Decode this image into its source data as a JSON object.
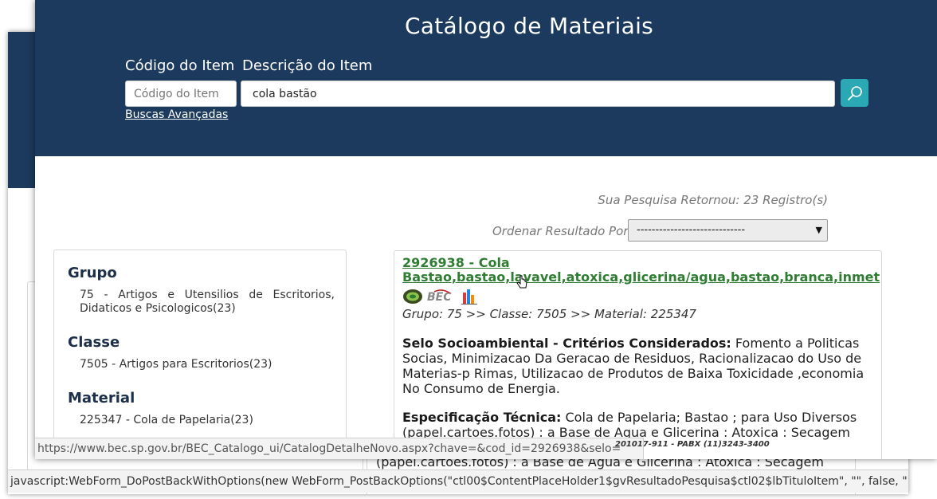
{
  "app": {
    "title": "Catálogo de Materiais"
  },
  "search": {
    "code_label": "Código do Item",
    "desc_label": "Descrição do Item",
    "code_placeholder": "Código do Item",
    "desc_value": "cola bastão",
    "advanced_link": "Buscas Avançadas",
    "search_icon": "search-icon"
  },
  "results_info": {
    "count_text": "Sua Pesquisa Retornou: 23 Registro(s)",
    "order_label": "Ordenar Resultado Por:",
    "order_value": "-----------------------------"
  },
  "filters": {
    "group_header": "Grupo",
    "group_item": "75 - Artigos e Utensilios de Escritorios, Didaticos e Psicologicos(23)",
    "class_header": "Classe",
    "class_item": "7505 - Artigos para Escritorios(23)",
    "material_header": "Material",
    "material_item": "225347 - Cola de Papelaria(23)"
  },
  "result": {
    "title_line1": "2926938 - Cola",
    "title_line2": "Bastao,bastao,lavavel,atoxica,glicerina/agua,bastao,branca,inmet",
    "path": "Grupo: 75 >> Classe: 7505 >> Material: 225347",
    "selo_label": "Selo Socioambiental - Critérios Considerados:",
    "selo_text": "Fomento a Politicas Socias, Minimizacao Da Geracao de Residuos, Racionalizacao do Uso de Materias-p Rimas, Utilizacao de Produtos de Baixa Toxicidade ,economia No Consumo de Energia.",
    "spec_label": "Especificação Técnica:",
    "spec_text": "Cola de Papelaria; Bastao ; para Uso Diversos (papel.cartoes.fotos) : a Base de Agua e Glicerina : Atoxica : Secagem",
    "icons": [
      "eco-leaf-icon",
      "bec-logo-icon",
      "chart-bars-icon"
    ]
  },
  "statusbars": {
    "front": "https://www.bec.sp.gov.br/BEC_Catalogo_ui/CatalogDetalheNovo.aspx?chave=&cod_id=2926938&selo=",
    "pabx": "201017-911 - PABX (11)3243-3400",
    "back": "javascript:WebForm_DoPostBackWithOptions(new WebForm_PostBackOptions(\"ctl00$ContentPlaceHolder1$gvResultadoPesquisa$ctl02$lbTituloItem\", \"\", false, \"\","
  },
  "back_window": {
    "spec_tail": "(papel.cartoes.fotos) : a Base de Agua e Glicerina : Atoxica : Secagem"
  },
  "colors": {
    "header_bg": "#1c3a5e",
    "accent": "#2aa8b3",
    "link_green": "#2e7d32"
  }
}
